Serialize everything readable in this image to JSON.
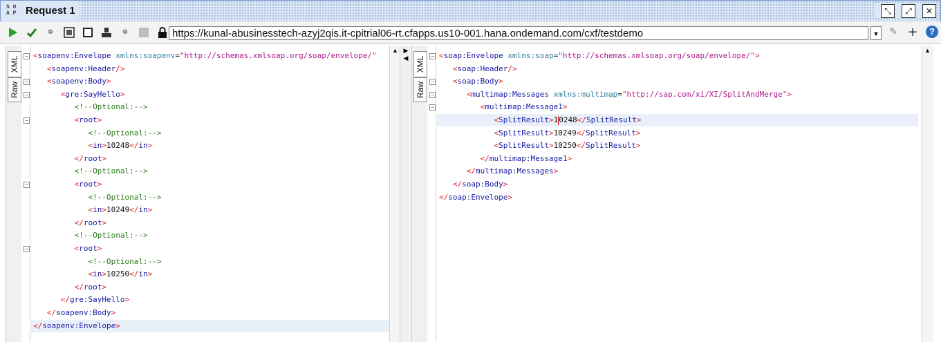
{
  "window": {
    "title": "Request 1",
    "logo_text": "SOAP"
  },
  "toolbar": {
    "url": "https://kunal-abusinesstech-azyj2qis.it-cpitrial06-rt.cfapps.us10-001.hana.ondemand.com/cxf/testdemo",
    "help_label": "?",
    "icons": [
      "play-icon",
      "submit-icon",
      "options-icon",
      "stop-icon",
      "square-icon",
      "user-icon",
      "options-icon",
      "gray-square-icon"
    ]
  },
  "request": {
    "tabs": [
      "XML",
      "Raw"
    ],
    "lines": [
      "<soapenv:Envelope xmlns:soapenv=\"http://schemas.xmlsoap.org/soap/envelope/\"",
      "   <soapenv:Header/>",
      "   <soapenv:Body>",
      "      <gre:SayHello>",
      "         <!--Optional:-->",
      "         <root>",
      "            <!--Optional:-->",
      "            <in>10248</in>",
      "         </root>",
      "         <!--Optional:-->",
      "         <root>",
      "            <!--Optional:-->",
      "            <in>10249</in>",
      "         </root>",
      "         <!--Optional:-->",
      "         <root>",
      "            <!--Optional:-->",
      "            <in>10250</in>",
      "         </root>",
      "      </gre:SayHello>",
      "   </soapenv:Body>",
      "</soapenv:Envelope>"
    ]
  },
  "response": {
    "tabs": [
      "XML",
      "Raw"
    ],
    "lines": [
      "<soap:Envelope xmlns:soap=\"http://schemas.xmlsoap.org/soap/envelope/\">",
      "   <soap:Header/>",
      "   <soap:Body>",
      "      <multimap:Messages xmlns:multimap=\"http://sap.com/xi/XI/SplitAndMerge\">",
      "         <multimap:Message1>",
      "            <SplitResult>10248</SplitResult>",
      "            <SplitResult>10249</SplitResult>",
      "            <SplitResult>10250</SplitResult>",
      "         </multimap:Message1>",
      "      </multimap:Messages>",
      "   </soap:Body>",
      "</soap:Envelope>"
    ]
  }
}
